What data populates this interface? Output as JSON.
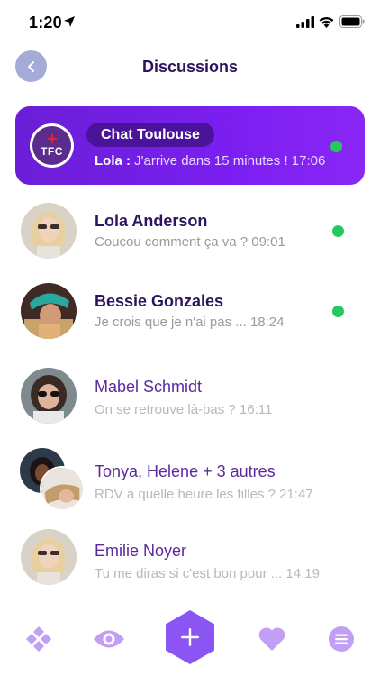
{
  "status_bar": {
    "time": "1:20"
  },
  "header": {
    "title": "Discussions"
  },
  "featured": {
    "group_name": "Chat Toulouse",
    "logo_text": "TFC",
    "sender": "Lola :",
    "message": "J'arrive dans 15 minutes ! 17:06",
    "online": true
  },
  "conversations": [
    {
      "name": "Lola Anderson",
      "preview": "Coucou comment ça va ? 09:01",
      "unread": true,
      "online": true
    },
    {
      "name": "Bessie Gonzales",
      "preview": "Je crois que je n'ai pas ... 18:24",
      "unread": true,
      "online": true
    },
    {
      "name": "Mabel Schmidt",
      "preview": "On se retrouve là-bas ? 16:11",
      "unread": false,
      "online": false
    },
    {
      "name": "Tonya, Helene + 3 autres",
      "preview": "RDV à quelle heure les filles ? 21:47",
      "unread": false,
      "online": false
    },
    {
      "name": "Emilie Noyer",
      "preview": "Tu me diras si c'est bon pour ... 14:19",
      "unread": false,
      "online": false
    }
  ],
  "colors": {
    "accent": "#7a1ff0",
    "accent_dark": "#4a1399",
    "online": "#27c95c",
    "tab_icon": "#c29ef5",
    "back_button": "#a6aad7"
  },
  "tab_bar": {
    "icons": [
      "diamond-cluster-icon",
      "eye-icon",
      "plus-icon",
      "heart-icon",
      "menu-icon"
    ]
  }
}
